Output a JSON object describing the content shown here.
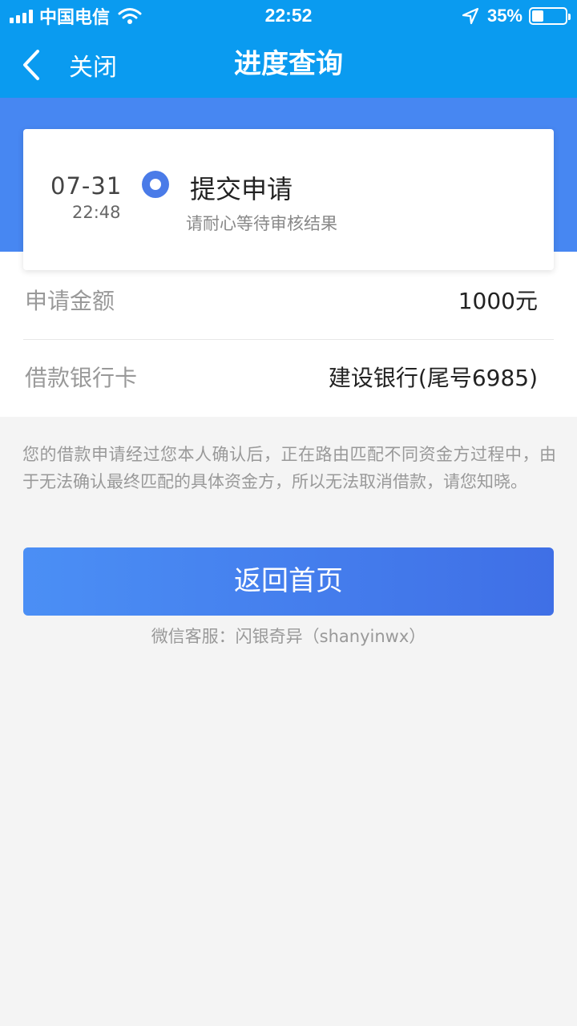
{
  "status_bar": {
    "carrier": "中国电信",
    "time": "22:52",
    "battery_percent": "35%",
    "battery_level": 0.35,
    "icons": [
      "signal-icon",
      "wifi-icon",
      "location-arrow-icon",
      "battery-icon"
    ]
  },
  "nav": {
    "back_label": "关闭",
    "title": "进度查询"
  },
  "status_card": {
    "date": "07-31",
    "time": "22:48",
    "title": "提交申请",
    "subtitle": "请耐心等待审核结果"
  },
  "details": [
    {
      "label": "申请金额",
      "value": "1000元"
    },
    {
      "label": "借款银行卡",
      "value": "建设银行(尾号6985)"
    }
  ],
  "notice": "您的借款申请经过您本人确认后，正在路由匹配不同资金方过程中，由于无法确认最终匹配的具体资金方，所以无法取消借款，请您知晓。",
  "home_button_label": "返回首页",
  "service_text": "微信客服：闪银奇异（shanyinwx）",
  "colors": {
    "status_bar_bg": "#0a9bf0",
    "band_bg": "#4787f2",
    "accent": "#4a7be8",
    "page_bg": "#f4f4f4"
  }
}
